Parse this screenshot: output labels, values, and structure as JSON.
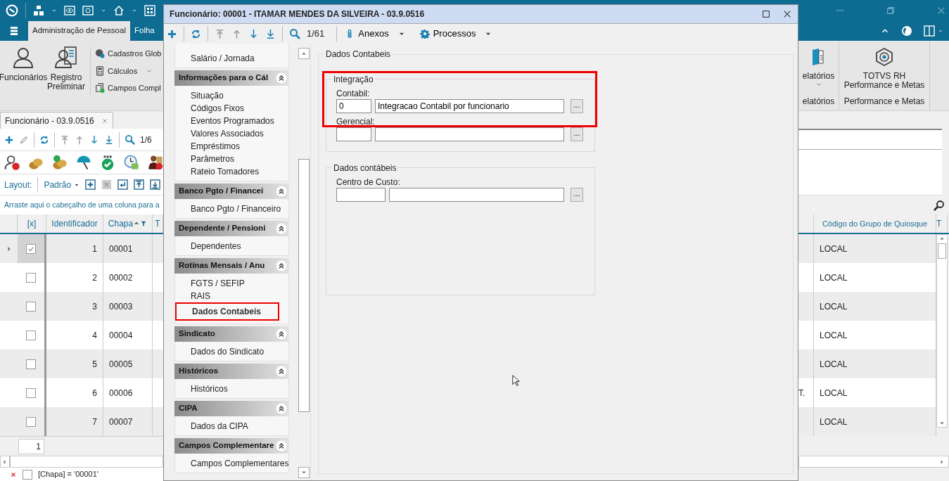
{
  "app": {
    "ribbon_tabs": [
      {
        "label": "Administração de Pessoal",
        "selected": true
      },
      {
        "label": "Folha",
        "selected": false
      }
    ],
    "ribbon_large_buttons": [
      {
        "label": "Funcionários"
      },
      {
        "label": "Registro Preliminar"
      }
    ],
    "ribbon_small_buttons": [
      {
        "label": "Cadastros Glob",
        "dropdown": false
      },
      {
        "label": "Cálculos",
        "dropdown": true
      },
      {
        "label": "Campos Compl",
        "dropdown": false
      }
    ],
    "ribbon_right_groups": [
      {
        "button": "elatórios",
        "dropdown": true,
        "group_label": "elatórios"
      },
      {
        "button": "TOTVS RH Performance e Metas",
        "dropdown": false,
        "group_label": "Performance e Metas"
      }
    ],
    "document_tab": {
      "label": "Funcionário - 03.9.0516"
    },
    "record_counter": "1/6",
    "layout": {
      "label": "Layout:",
      "value": "Padrão"
    },
    "group_hint": "Arraste aqui o cabeçalho de uma coluna para a",
    "grid": {
      "columns": [
        {
          "label": "[x]",
          "sorted": false
        },
        {
          "label": "Identificador",
          "sorted": false
        },
        {
          "label": "Chapa",
          "sorted": true
        },
        {
          "label": "T",
          "sorted": false
        }
      ],
      "right_columns": [
        "Código do Grupo de Quiosque",
        "T"
      ],
      "rows": [
        {
          "selected": true,
          "checked": true,
          "id": "1",
          "chapa": "00001",
          "grupo": "LOCAL"
        },
        {
          "selected": false,
          "checked": false,
          "id": "2",
          "chapa": "00002",
          "grupo": "LOCAL"
        },
        {
          "selected": false,
          "checked": false,
          "id": "3",
          "chapa": "00003",
          "grupo": "LOCAL"
        },
        {
          "selected": false,
          "checked": false,
          "id": "4",
          "chapa": "00004",
          "grupo": "LOCAL"
        },
        {
          "selected": false,
          "checked": false,
          "id": "5",
          "chapa": "00005",
          "grupo": "LOCAL"
        },
        {
          "selected": false,
          "checked": false,
          "id": "6",
          "chapa": "00006",
          "partial": "T.",
          "grupo": "LOCAL"
        },
        {
          "selected": false,
          "checked": false,
          "id": "7",
          "chapa": "00007",
          "grupo": "LOCAL"
        }
      ]
    },
    "pager": "1",
    "filter": "[Chapa] = '00001'",
    "filter_enabled": false
  },
  "dialog": {
    "title": "Funcionário: 00001 - ITAMAR MENDES DA SILVEIRA - 03.9.0516",
    "record_counter": "1/61",
    "menus": [
      "Anexos",
      "Processos"
    ],
    "nav": {
      "top_items": [
        {
          "label": "Salário / Jornada",
          "selected": false
        }
      ],
      "groups": [
        {
          "title": "Informações para o Cál",
          "items": [
            {
              "label": "Situação",
              "selected": false
            },
            {
              "label": "Códigos Fixos",
              "selected": false
            },
            {
              "label": "Eventos Programados",
              "selected": false
            },
            {
              "label": "Valores Associados",
              "selected": false
            },
            {
              "label": "Empréstimos",
              "selected": false
            },
            {
              "label": "Parâmetros",
              "selected": false
            },
            {
              "label": "Rateio Tomadores",
              "selected": false
            }
          ]
        },
        {
          "title": "Banco Pgto / Financei",
          "items": [
            {
              "label": "Banco Pgto / Financeiro",
              "selected": false
            }
          ]
        },
        {
          "title": "Dependente / Pensioni",
          "items": [
            {
              "label": "Dependentes",
              "selected": false
            }
          ]
        },
        {
          "title": "Rotinas Mensais / Anu",
          "items": [
            {
              "label": "FGTS / SEFIP",
              "selected": false
            },
            {
              "label": "RAIS",
              "selected": false
            },
            {
              "label": "Dados Contabeis",
              "selected": true
            }
          ]
        },
        {
          "title": "Sindicato",
          "items": [
            {
              "label": "Dados do Sindicato",
              "selected": false
            }
          ]
        },
        {
          "title": "Históricos",
          "items": [
            {
              "label": "Históricos",
              "selected": false
            }
          ]
        },
        {
          "title": "CIPA",
          "items": [
            {
              "label": "Dados da CIPA",
              "selected": false
            }
          ]
        },
        {
          "title": "Campos Complementare",
          "items": [
            {
              "label": "Campos Complementares",
              "selected": false
            }
          ]
        }
      ]
    },
    "form": {
      "title": "Dados Contabeis",
      "groups": [
        {
          "title": "Integração",
          "highlighted": true,
          "fields": [
            {
              "label": "Contabil:",
              "code": "0",
              "description": "Integracao Contabil por funcionario",
              "wide_code": false,
              "button": "..."
            },
            {
              "label": "Gerencial:",
              "wide_code": false,
              "button": "..."
            }
          ]
        },
        {
          "title": "Dados contábeis",
          "highlighted": false,
          "fields": [
            {
              "label": "Centro de Custo:",
              "wide_code": true,
              "button": "..."
            }
          ]
        }
      ]
    }
  }
}
